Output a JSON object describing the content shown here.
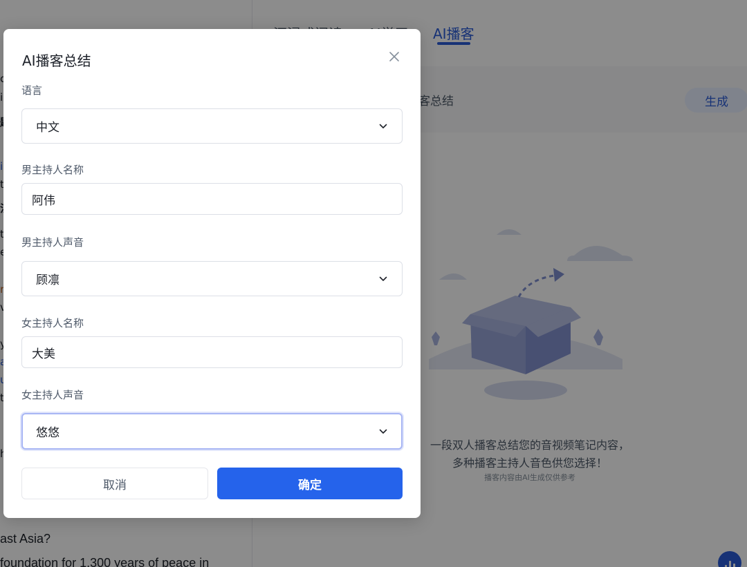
{
  "background": {
    "left_fragments": [
      "c",
      "i",
      "题",
      "i",
      "t",
      "泛",
      "t",
      "e",
      "r",
      "v",
      "y",
      "a",
      "u",
      "t",
      "h"
    ],
    "left_texts": [
      "ast Asia?",
      "foundation for 1,300 years of peace in"
    ],
    "tabs": [
      {
        "label": "沉浸式阅读"
      },
      {
        "label": "AI学习"
      },
      {
        "label": "AI播客"
      }
    ],
    "toolbar_label": "客总结",
    "generate_label": "生成",
    "empty_state": {
      "line1": "一段双人播客总结您的音视频笔记内容，",
      "line2": "多种播客主持人音色供您选择！",
      "note": "播客内容由AI生成仅供参考"
    }
  },
  "dialog": {
    "title": "AI播客总结",
    "language": {
      "label": "语言",
      "value": "中文"
    },
    "male_host_name": {
      "label": "男主持人名称",
      "value": "阿伟"
    },
    "male_host_voice": {
      "label": "男主持人声音",
      "value": "顾凛"
    },
    "female_host_name": {
      "label": "女主持人名称",
      "value": "大美"
    },
    "female_host_voice": {
      "label": "女主持人声音",
      "value": "悠悠"
    },
    "cancel_label": "取消",
    "confirm_label": "确定"
  },
  "colors": {
    "accent": "#2563eb",
    "tab_active": "#2a5bd7",
    "overlay": "rgba(0,0,0,0.45)"
  }
}
